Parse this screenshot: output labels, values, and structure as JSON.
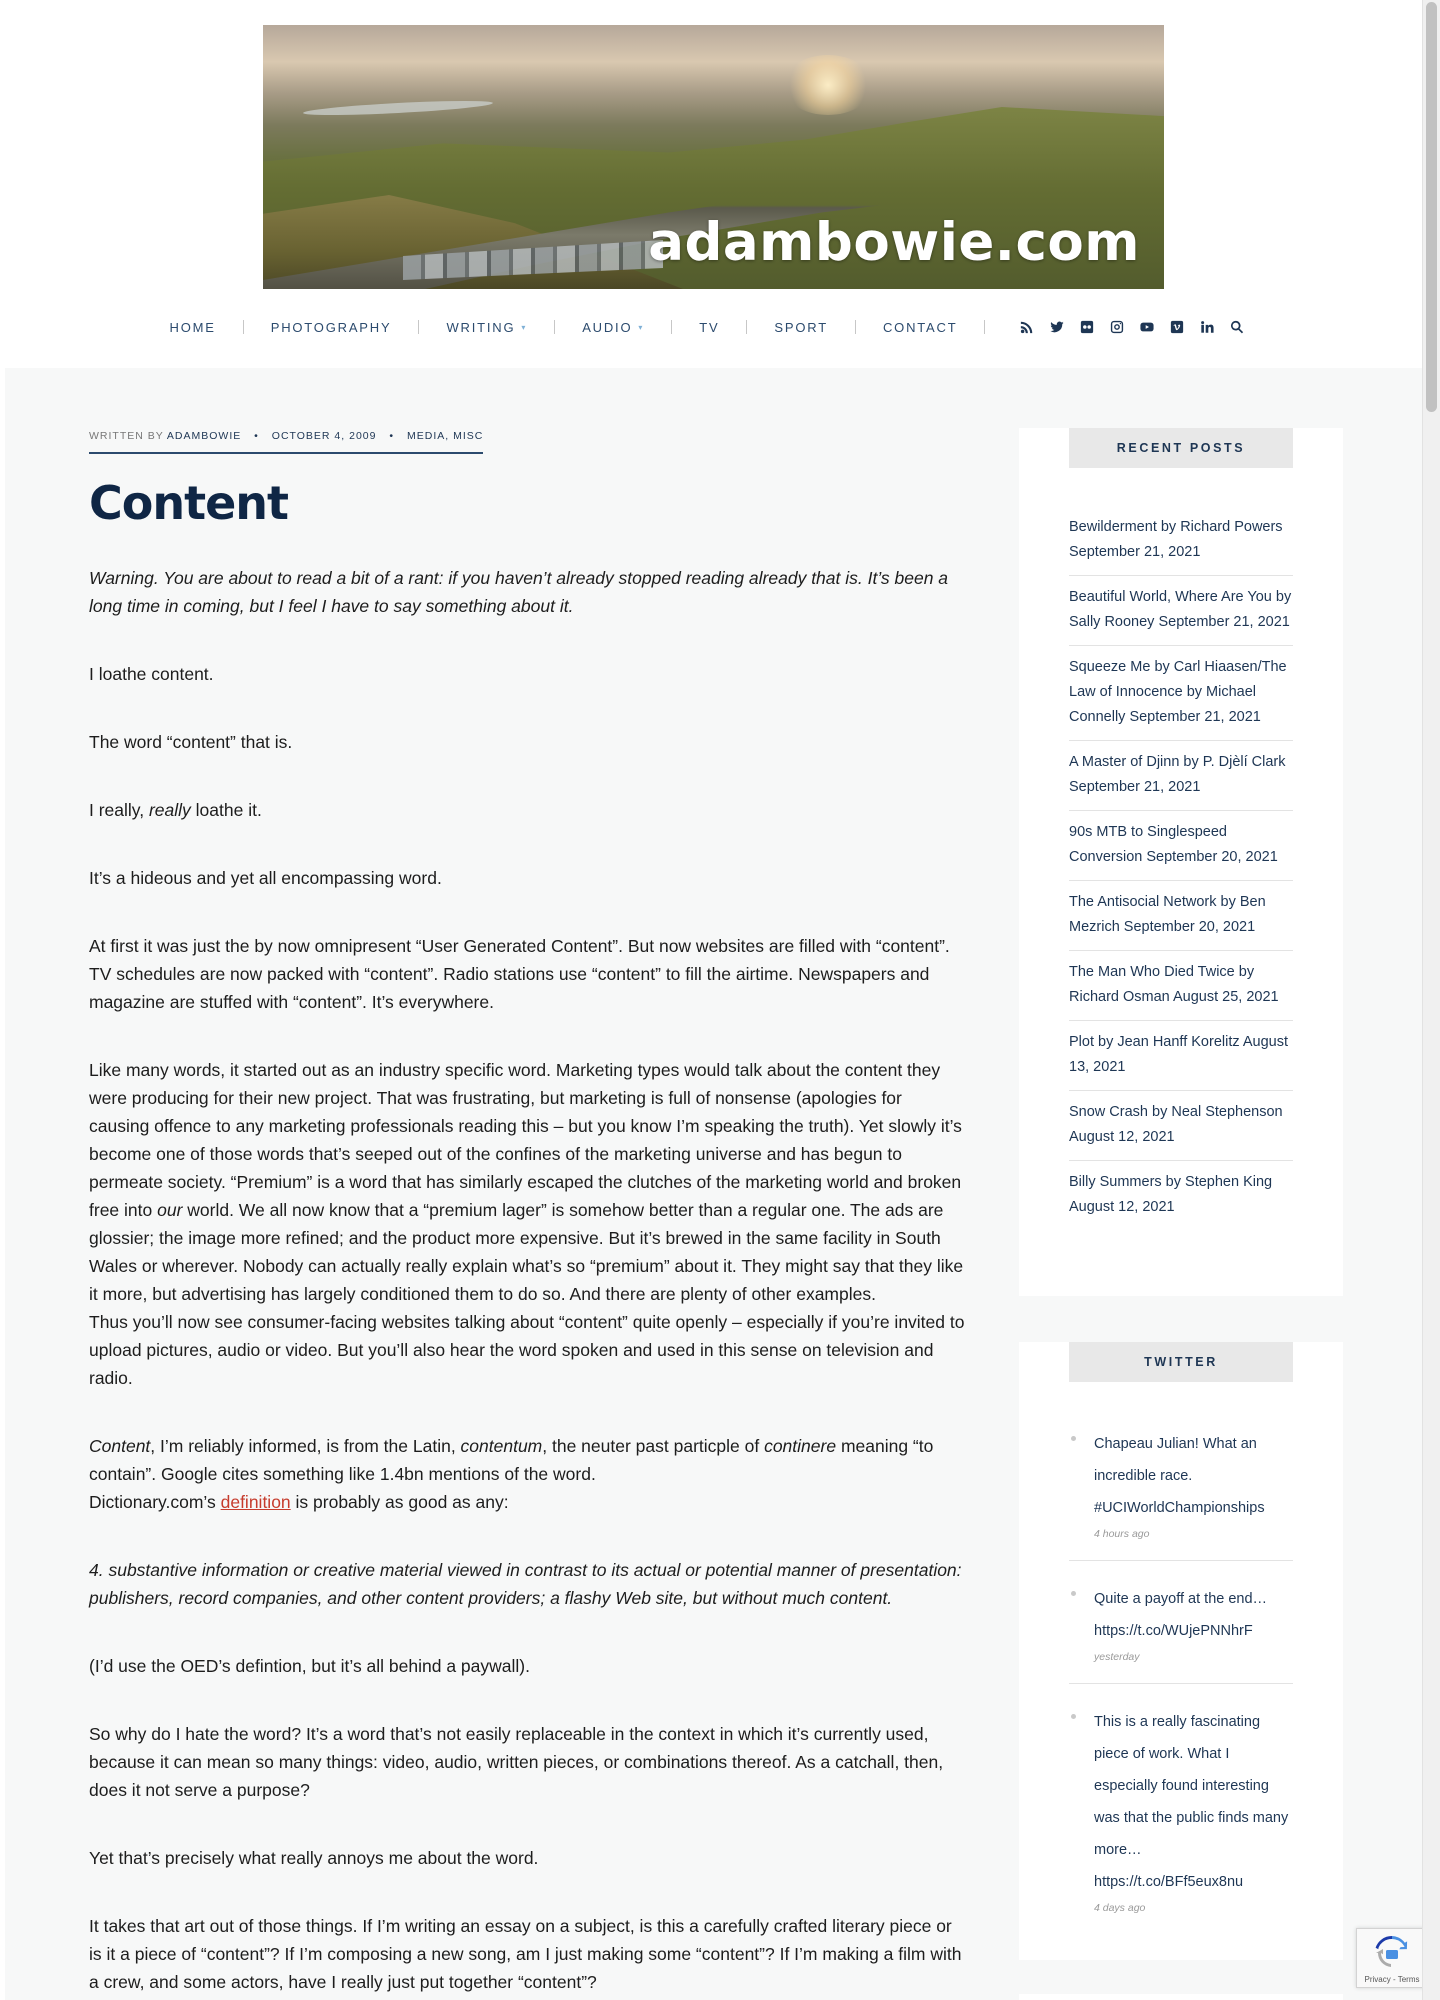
{
  "site": {
    "logo_text": "adambowie.com"
  },
  "nav": {
    "items": [
      {
        "label": "Home",
        "has_caret": false
      },
      {
        "label": "Photography",
        "has_caret": false
      },
      {
        "label": "Writing",
        "has_caret": true
      },
      {
        "label": "Audio",
        "has_caret": true
      },
      {
        "label": "TV",
        "has_caret": false
      },
      {
        "label": "Sport",
        "has_caret": false
      },
      {
        "label": "Contact",
        "has_caret": false
      }
    ],
    "caret": "▾",
    "icons": [
      "rss-icon",
      "twitter-icon",
      "flickr-icon",
      "instagram-icon",
      "youtube-icon",
      "vimeo-icon",
      "linkedin-icon",
      "search-icon"
    ]
  },
  "article": {
    "meta": {
      "written_by": "Written by",
      "author": "adambowie",
      "sep": "•",
      "date": "October 4, 2009",
      "categories": "Media, Misc"
    },
    "title": "Content",
    "intro": "Warning. You are about to read a bit of a rant: if you haven’t already stopped reading already that is. It’s been a long time in coming, but I feel I have to say something about it.",
    "p1": "I loathe content.",
    "p2": "The word “content” that is.",
    "p3_a": "I really, ",
    "p3_em": "really",
    "p3_b": " loathe it.",
    "p4": "It’s a hideous and yet all encompassing word.",
    "p5": "At first it was just the by now omnipresent “User Generated Content”. But now websites are filled with “content”. TV schedules are now packed with “content”. Radio stations use “content” to fill the airtime. Newspapers and magazine are stuffed with “content”. It’s everywhere.",
    "p6_a": "Like many words, it started out as an industry specific word. Marketing types would talk about the content they were producing for their new project. That was frustrating, but marketing is full of nonsense (apologies for causing offence to any marketing professionals reading this – but you know I’m speaking the truth). Yet slowly it’s become one of those words that’s seeped out of the confines of the marketing universe and has begun to permeate society. “Premium” is a word that has similarly escaped the clutches of the marketing world and broken free into ",
    "p6_em": "our",
    "p6_b": " world. We all now know that a “premium lager” is somehow better than a regular one. The ads are glossier; the image more refined; and the product more expensive. But it’s brewed in the same facility in South Wales or wherever. Nobody can actually really explain what’s so “premium” about it. They might say that they like it more, but advertising has largely conditioned them to do so. And there are plenty of other examples.",
    "p7": "Thus you’ll now see consumer-facing websites talking about “content” quite openly – especially if you’re invited to upload pictures, audio or video. But you’ll also hear the word spoken and used in this sense on television and radio.",
    "p8_em1": "Content",
    "p8_a": ", I’m reliably informed, is from the Latin, ",
    "p8_em2": "contentum",
    "p8_b": ", the neuter past particple of ",
    "p8_em3": "continere",
    "p8_c": " meaning “to contain”. Google cites something like 1.4bn mentions of the word.",
    "p9_a": "Dictionary.com’s ",
    "p9_link": "definition",
    "p9_b": " is probably as good as any:",
    "quote": "4. substantive information or creative material viewed in contrast to its actual or potential manner of presentation: publishers, record companies, and other content providers; a flashy Web site, but without much content.",
    "p10": "(I’d use the OED’s defintion, but it’s all behind a paywall).",
    "p11": "So why do I hate the word? It’s a word that’s not easily replaceable in the context in which it’s currently used, because it can mean so many things: video, audio, written pieces, or combinations thereof. As a catchall, then, does it not serve a purpose?",
    "p12": "Yet that’s precisely what really annoys me about the word.",
    "p13": "It takes that art out of those things. If I’m writing an essay on a subject, is this a carefully crafted literary piece or is it a piece of “content”? If I’m composing a new song, am I just making some “content”? If I’m making a film with a crew, and some actors, have I really just put together “content”?"
  },
  "sidebar": {
    "recent_title": "Recent Posts",
    "recent_posts": [
      "Bewilderment by Richard Powers September 21, 2021",
      "Beautiful World, Where Are You by Sally Rooney September 21, 2021",
      "Squeeze Me by Carl Hiaasen/The Law of Innocence by Michael Connelly September 21, 2021",
      "A Master of Djinn by P. Djèlí Clark September 21, 2021",
      "90s MTB to Singlespeed Conversion September 20, 2021",
      "The Antisocial Network by Ben Mezrich September 20, 2021",
      "The Man Who Died Twice by Richard Osman August 25, 2021",
      "Plot by Jean Hanff Korelitz August 13, 2021",
      "Snow Crash by Neal Stephenson August 12, 2021",
      "Billy Summers by Stephen King August 12, 2021"
    ],
    "twitter_title": "Twitter",
    "tweets": [
      {
        "text": "Chapeau Julian! What an incredible race. #UCIWorldChampionships",
        "ago": "4 hours ago"
      },
      {
        "text": "Quite a payoff at the end… https://t.co/WUjePNNhrF",
        "ago": "yesterday"
      },
      {
        "text": "This is a really fascinating piece of work. What I especially found interesting was that the public finds many more… https://t.co/BFf5eux8nu",
        "ago": "4 days ago"
      }
    ]
  },
  "recaptcha": {
    "label": "Privacy - Terms"
  }
}
